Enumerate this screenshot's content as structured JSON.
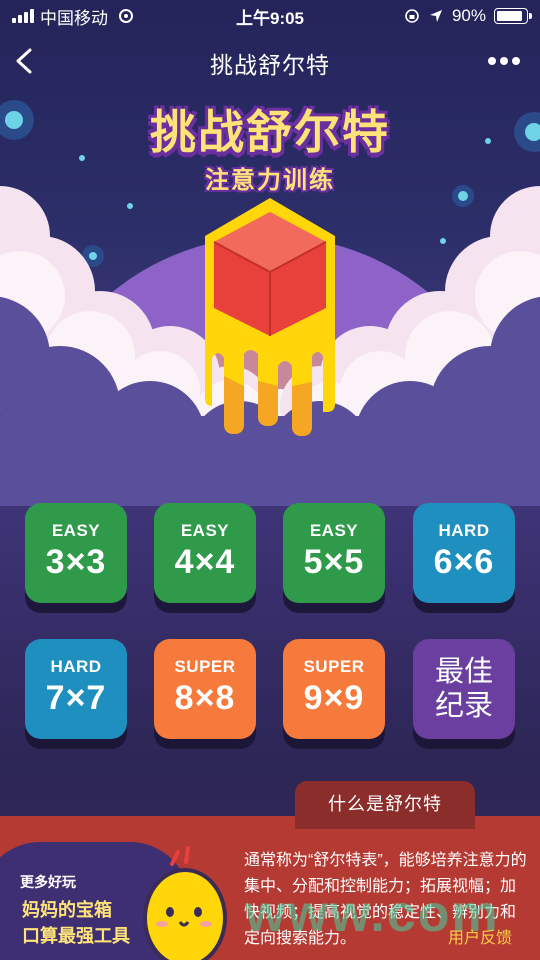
{
  "status_bar": {
    "carrier": "中国移动",
    "time": "上午9:05",
    "battery_percent": "90%",
    "battery_level": 0.9
  },
  "nav": {
    "title": "挑战舒尔特",
    "back_icon": "chevron-left-icon",
    "more_icon": "more-dots-icon"
  },
  "hero": {
    "title": "挑战舒尔特",
    "subtitle": "注意力训练"
  },
  "levels": [
    {
      "difficulty": "EASY",
      "size": "3×3",
      "color": "#2e9a4a"
    },
    {
      "difficulty": "EASY",
      "size": "4×4",
      "color": "#2e9a4a"
    },
    {
      "difficulty": "EASY",
      "size": "5×5",
      "color": "#2e9a4a"
    },
    {
      "difficulty": "HARD",
      "size": "6×6",
      "color": "#1e8fbf"
    },
    {
      "difficulty": "HARD",
      "size": "7×7",
      "color": "#1e8fbf"
    },
    {
      "difficulty": "SUPER",
      "size": "8×8",
      "color": "#f57a3c"
    },
    {
      "difficulty": "SUPER",
      "size": "9×9",
      "color": "#f57a3c"
    }
  ],
  "best_record": {
    "line1": "最佳",
    "line2": "纪录",
    "color": "#6a3fa0"
  },
  "info": {
    "tab_label": "什么是舒尔特",
    "description": "通常称为“舒尔特表”，能够培养注意力的集中、分配和控制能力；拓展视幅；加快视频；提高视觉的稳定性、辨别力和定向搜索能力。"
  },
  "promo": {
    "heading": "更多好玩",
    "line1": "妈妈的宝箱",
    "line2": "口算最强工具"
  },
  "feedback_label": "用户反馈",
  "watermark": "www.com",
  "colors": {
    "accent_yellow": "#ffe27a",
    "title_outline": "#6b2fa1",
    "panel_red": "#b53a33"
  }
}
